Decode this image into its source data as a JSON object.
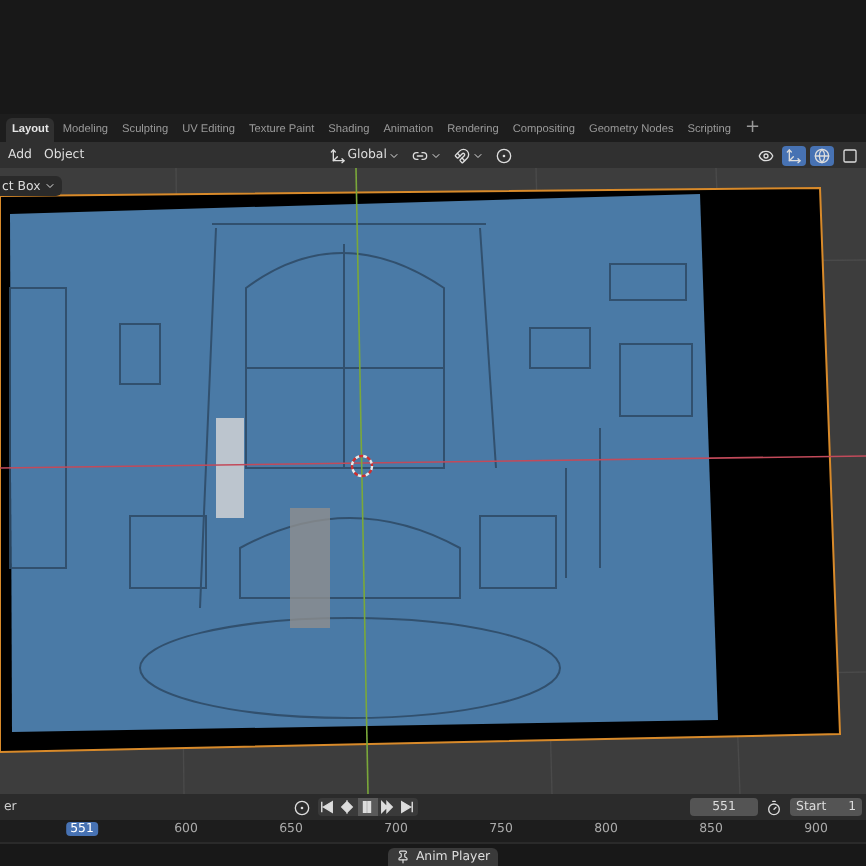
{
  "workspace_tabs": [
    {
      "label": "Layout",
      "selected": true
    },
    {
      "label": "Modeling",
      "selected": false
    },
    {
      "label": "Sculpting",
      "selected": false
    },
    {
      "label": "UV Editing",
      "selected": false
    },
    {
      "label": "Texture Paint",
      "selected": false
    },
    {
      "label": "Shading",
      "selected": false
    },
    {
      "label": "Animation",
      "selected": false
    },
    {
      "label": "Rendering",
      "selected": false
    },
    {
      "label": "Compositing",
      "selected": false
    },
    {
      "label": "Geometry Nodes",
      "selected": false
    },
    {
      "label": "Scripting",
      "selected": false
    }
  ],
  "add_tab": "+",
  "header": {
    "menus": [
      "Add",
      "Object"
    ],
    "orientation": "Global"
  },
  "viewport": {
    "object_dropdown": "ct Box"
  },
  "timeline": {
    "menu_label": "er",
    "playing": true,
    "current_frame": "551",
    "start_label": "Start",
    "start_value": "1"
  },
  "ruler": {
    "current": "551",
    "ticks": [
      "600",
      "650",
      "700",
      "750",
      "800",
      "850",
      "900"
    ]
  },
  "status_bar": {
    "badge": "Anim Player"
  }
}
